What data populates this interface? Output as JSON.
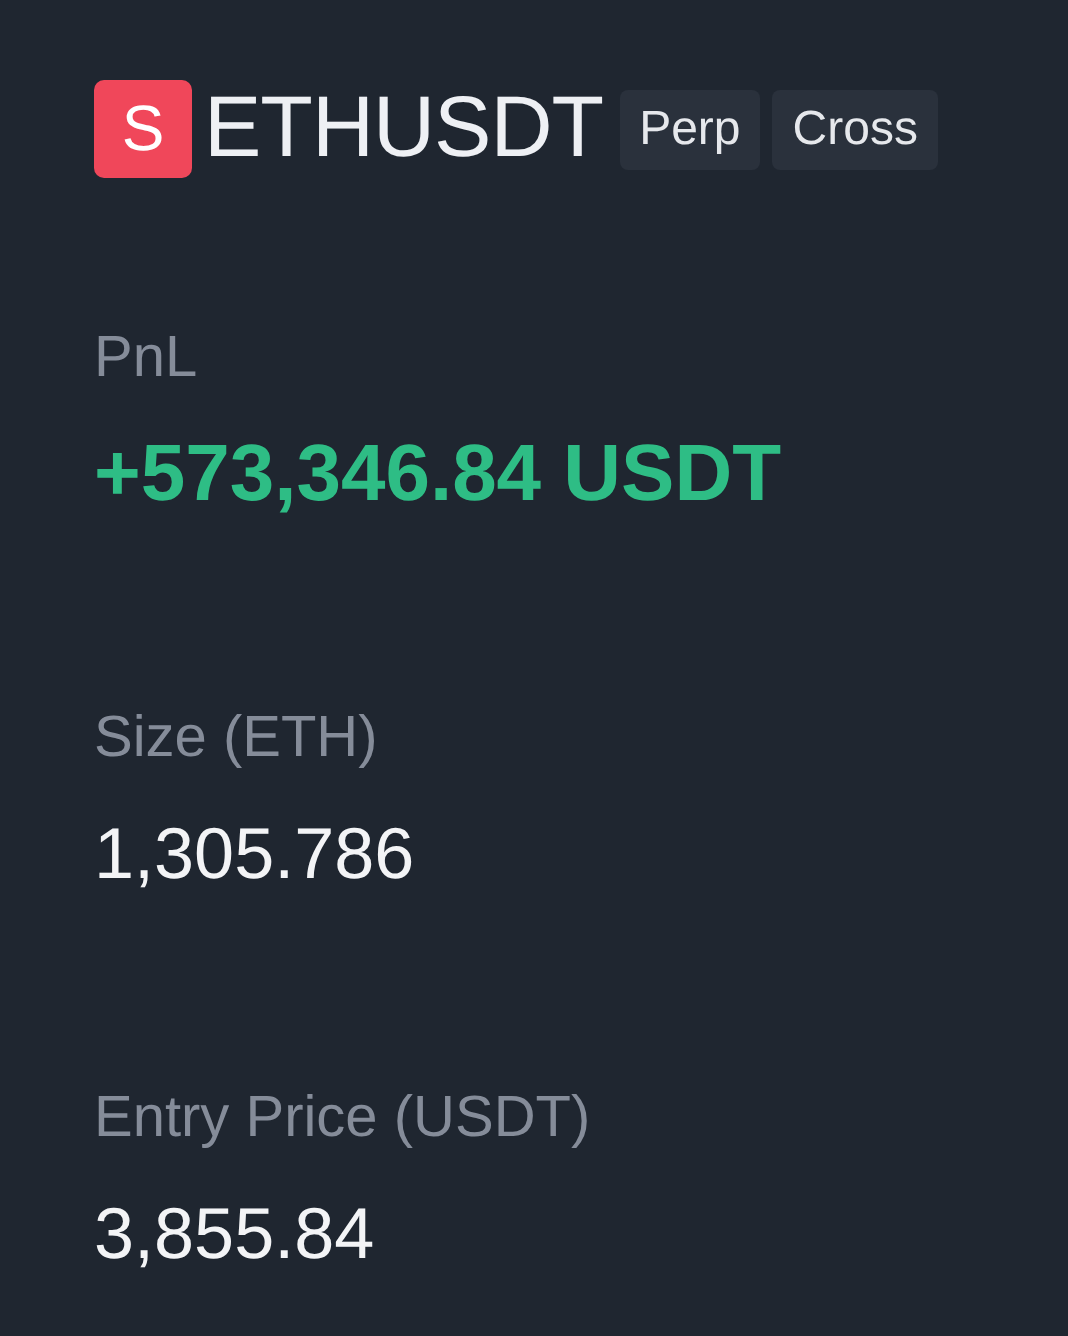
{
  "header": {
    "side_badge": "S",
    "symbol": "ETHUSDT",
    "tags": [
      "Perp",
      "Cross"
    ]
  },
  "fields": [
    {
      "label": "PnL",
      "value": "+573,346.84 USDT",
      "kind": "profit"
    },
    {
      "label": "Size (ETH)",
      "value": "1,305.786",
      "kind": "plain"
    },
    {
      "label": "Entry Price (USDT)",
      "value": "3,855.84",
      "kind": "plain"
    }
  ]
}
